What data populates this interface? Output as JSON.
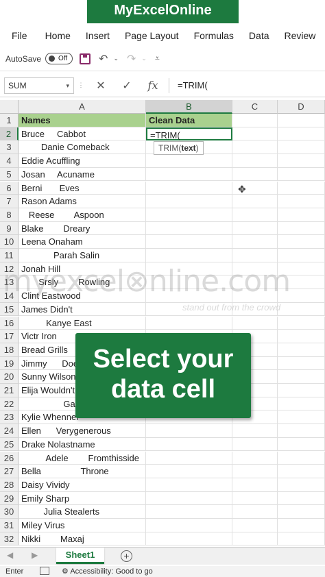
{
  "title": "MyExcelOnline",
  "menu": [
    "File",
    "Home",
    "Insert",
    "Page Layout",
    "Formulas",
    "Data",
    "Review"
  ],
  "qat": {
    "autosave_label": "AutoSave",
    "toggle_label": "Off"
  },
  "formula_bar": {
    "name_box": "SUM",
    "cancel": "✕",
    "enter": "✓",
    "fx": "fx",
    "formula": "=TRIM("
  },
  "columns": [
    "A",
    "B",
    "C",
    "D"
  ],
  "rows": [
    {
      "n": "1",
      "a": "Names",
      "b": "Clean Data"
    },
    {
      "n": "2",
      "a": "Bruce     Cabbot",
      "b": "=TRIM("
    },
    {
      "n": "3",
      "a": "        Danie Comeback",
      "b": ""
    },
    {
      "n": "4",
      "a": "Eddie Acuffling",
      "b": ""
    },
    {
      "n": "5",
      "a": "Josan     Acuname",
      "b": ""
    },
    {
      "n": "6",
      "a": "Berni       Eves",
      "b": ""
    },
    {
      "n": "7",
      "a": "Rason Adams",
      "b": ""
    },
    {
      "n": "8",
      "a": "   Reese        Aspoon",
      "b": ""
    },
    {
      "n": "9",
      "a": "Blake        Dreary",
      "b": ""
    },
    {
      "n": "10",
      "a": "Leena Onaham",
      "b": ""
    },
    {
      "n": "11",
      "a": "             Parah Salin",
      "b": ""
    },
    {
      "n": "12",
      "a": "Jonah Hill",
      "b": ""
    },
    {
      "n": "13",
      "a": "       Srsly        Rowling",
      "b": ""
    },
    {
      "n": "14",
      "a": "Clint Eastwood",
      "b": ""
    },
    {
      "n": "15",
      "a": "James Didn't",
      "b": ""
    },
    {
      "n": "16",
      "a": "          Kanye East",
      "b": ""
    },
    {
      "n": "17",
      "a": "Victr Iron",
      "b": ""
    },
    {
      "n": "18",
      "a": "Bread Grills",
      "b": ""
    },
    {
      "n": "19",
      "a": "Jimmy      Does",
      "b": ""
    },
    {
      "n": "20",
      "a": "Sunny Wilson",
      "b": ""
    },
    {
      "n": "21",
      "a": "Elija Wouldn't",
      "b": ""
    },
    {
      "n": "22",
      "a": "                 Garr",
      "b": ""
    },
    {
      "n": "23",
      "a": "Kylie Whenner",
      "b": ""
    },
    {
      "n": "24",
      "a": "Ellen      Verygenerous",
      "b": ""
    },
    {
      "n": "25",
      "a": "Drake Nolastname",
      "b": ""
    },
    {
      "n": "26",
      "a": "          Adele        Fromthisside",
      "b": ""
    },
    {
      "n": "27",
      "a": "Bella                Throne",
      "b": ""
    },
    {
      "n": "28",
      "a": "Daisy Vividy",
      "b": ""
    },
    {
      "n": "29",
      "a": "Emily Sharp",
      "b": ""
    },
    {
      "n": "30",
      "a": "         Julia Stealerts",
      "b": ""
    },
    {
      "n": "31",
      "a": "Miley Virus",
      "b": ""
    },
    {
      "n": "32",
      "a": "Nikki        Maxaj",
      "b": ""
    }
  ],
  "tooltip": {
    "fn": "TRIM(",
    "arg": "text",
    "close": ")"
  },
  "watermark": {
    "text": "myexcel⊗nline.com",
    "tagline": "stand out from the crowd"
  },
  "banner": {
    "line1": "Select your",
    "line2": "data cell"
  },
  "sheet": {
    "tab": "Sheet1",
    "add": "+"
  },
  "status": {
    "mode": "Enter",
    "accessibility": "Accessibility: Good to go"
  },
  "colors": {
    "brand_green": "#1d7a3f",
    "header_fill": "#a9d18e"
  }
}
